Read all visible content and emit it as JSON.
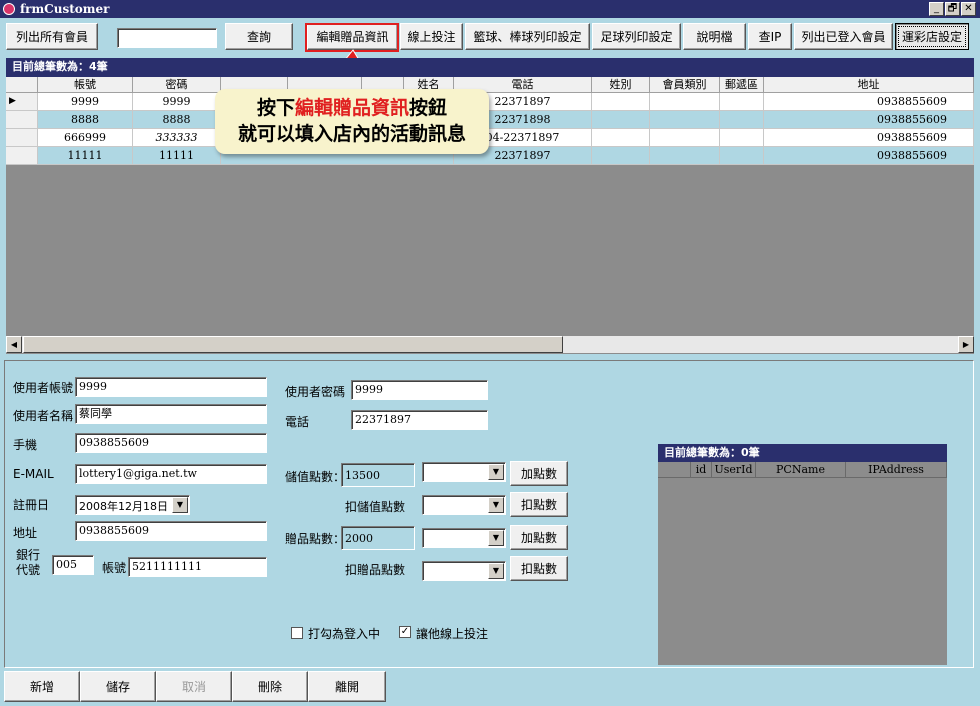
{
  "window": {
    "title": "frmCustomer",
    "min": "_",
    "max": "🗗",
    "close": "✕"
  },
  "toolbar": {
    "list_all": "列出所有會員",
    "search_value": "",
    "query": "查詢",
    "edit_gifts": "編輯贈品資訊",
    "online_bet": "線上投注",
    "basketball_print": "籃球、棒球列印設定",
    "soccer_print": "足球列印設定",
    "help": "說明檔",
    "check_ip": "查IP",
    "list_logged": "列出已登入會員",
    "lottery_settings": "運彩店設定"
  },
  "grid": {
    "count_label": "目前總筆數為：4筆",
    "columns": [
      "帳號",
      "密碼",
      "",
      "",
      "",
      "姓名",
      "電話",
      "姓別",
      "會員類別",
      "郵遞區",
      "地址"
    ],
    "rows": [
      {
        "marker": "▶",
        "account": "9999",
        "password": "9999",
        "phone": "22371897",
        "address": "0938855609"
      },
      {
        "marker": "",
        "account": "8888",
        "password": "8888",
        "phone": "22371898",
        "address": "0938855609"
      },
      {
        "marker": "",
        "account": "666999",
        "password": "333333",
        "phone": "04-22371897",
        "address": "0938855609"
      },
      {
        "marker": "",
        "account": "11111",
        "password": "11111",
        "phone": "22371897",
        "address": "0938855609"
      }
    ]
  },
  "callout": {
    "prefix": "按下",
    "highlight": "編輯贈品資訊",
    "suffix": "按鈕",
    "line2": "就可以填入店內的活動訊息"
  },
  "form": {
    "account_label": "使用者帳號",
    "account": "9999",
    "name_label": "使用者名稱",
    "name": "蔡同學",
    "mobile_label": "手機",
    "mobile": "0938855609",
    "email_label": "E-MAIL",
    "email": "lottery1@giga.net.tw",
    "regdate_label": "註冊日",
    "regdate": "2008年12月18日",
    "address_label": "地址",
    "address": "0938855609",
    "bank_label1": "銀行",
    "bank_label2": "代號",
    "bank_code": "005",
    "bankacct_label": "帳號",
    "bankacct": "5211111111",
    "password_label": "使用者密碼",
    "password": "9999",
    "phone_label": "電話",
    "phone": "22371897",
    "stored_points_label": "儲值點數：",
    "stored_points": "13500",
    "deduct_stored_label": "扣儲值點數",
    "gift_points_label": "贈品點數：",
    "gift_points": "2000",
    "deduct_gift_label": "扣贈品點數",
    "add_points": "加點數",
    "deduct_points": "扣點數",
    "logged_in_label": "打勾為登入中",
    "allow_online_label": "讓他線上投注"
  },
  "login_grid": {
    "count_label": "目前總筆數為：0筆",
    "columns": [
      "id",
      "UserId",
      "PCName",
      "IPAddress"
    ]
  },
  "bottom": {
    "add": "新增",
    "save": "儲存",
    "cancel": "取消",
    "delete": "刪除",
    "exit": "離開"
  },
  "colors": {
    "title_bg": "#2a2f6d",
    "panel_bg": "#afd7e3",
    "grid_bg": "#8c8c8c",
    "highlight_red": "#e02020"
  }
}
